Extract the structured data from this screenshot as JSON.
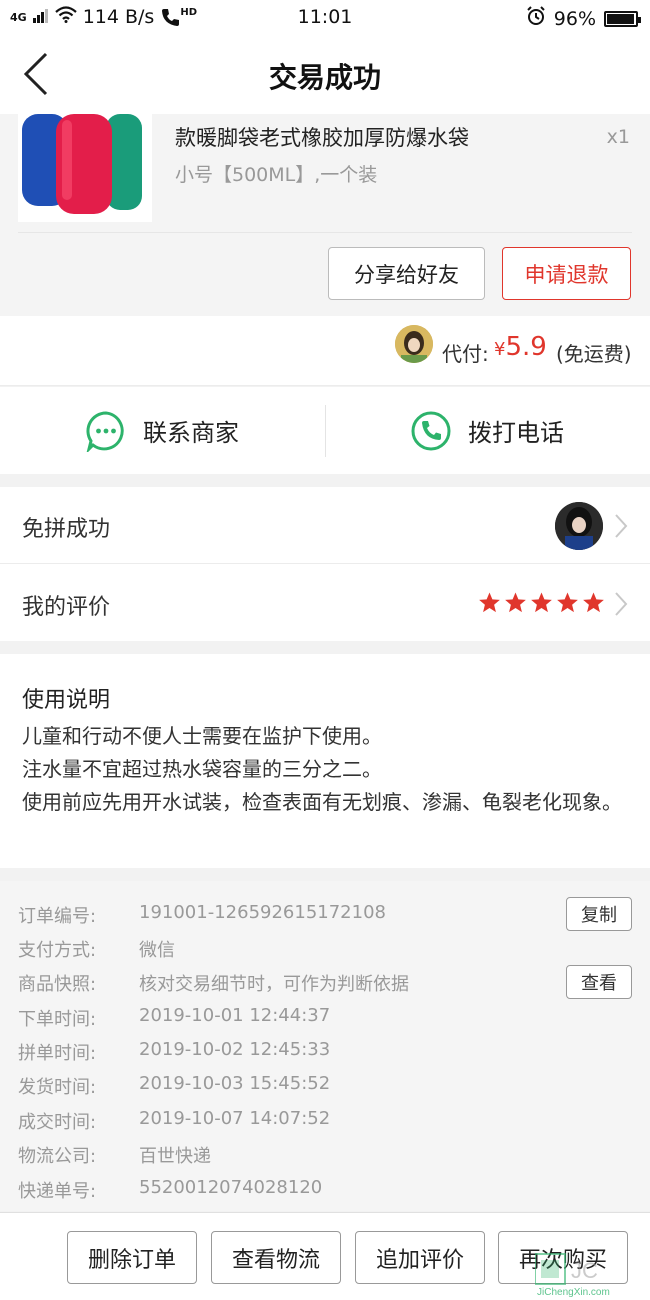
{
  "status_bar": {
    "network": "4G",
    "speed": "114 B/s",
    "hd": "HD",
    "time": "11:01",
    "battery": "96%",
    "battery_level": 0.96
  },
  "nav": {
    "title": "交易成功"
  },
  "product": {
    "name": "款暖脚袋老式橡胶加厚防爆水袋",
    "spec": "小号【500ML】,一个装",
    "quantity": "x1",
    "share_label": "分享给好友",
    "refund_label": "申请退款"
  },
  "payment": {
    "label": "代付:",
    "currency": "¥",
    "amount": "5.9",
    "shipping_note": "(免运费)"
  },
  "contact": {
    "merchant_label": "联系商家",
    "phone_label": "拨打电话"
  },
  "info": {
    "pin_label": "免拼成功",
    "review_label": "我的评价",
    "rating": 5,
    "rating_max": 5
  },
  "usage": {
    "title": "使用说明",
    "text": "儿童和行动不便人士需要在监护下使用。\n注水量不宜超过热水袋容量的三分之二。\n使用前应先用开水试装，检查表面有无划痕、渗漏、龟裂老化现象。"
  },
  "details": [
    {
      "key": "订单编号:",
      "value": "191001-126592615172108",
      "button": "复制"
    },
    {
      "key": "支付方式:",
      "value": "微信"
    },
    {
      "key": "商品快照:",
      "value": "核对交易细节时，可作为判断依据",
      "button": "查看"
    },
    {
      "key": "下单时间:",
      "value": "2019-10-01 12:44:37"
    },
    {
      "key": "拼单时间:",
      "value": "2019-10-02 12:45:33"
    },
    {
      "key": "发货时间:",
      "value": "2019-10-03 15:45:52"
    },
    {
      "key": "成交时间:",
      "value": "2019-10-07 14:07:52"
    },
    {
      "key": "物流公司:",
      "value": "百世快递"
    },
    {
      "key": "快递单号:",
      "value": "5520012074028120"
    }
  ],
  "bottom_actions": {
    "delete": "删除订单",
    "logistics": "查看物流",
    "add_review": "追加评价",
    "rebuy": "再次购买"
  },
  "watermark": {
    "text": "JiChengXin.com"
  },
  "colors": {
    "accent_red": "#e0362c",
    "green": "#2db36b"
  }
}
